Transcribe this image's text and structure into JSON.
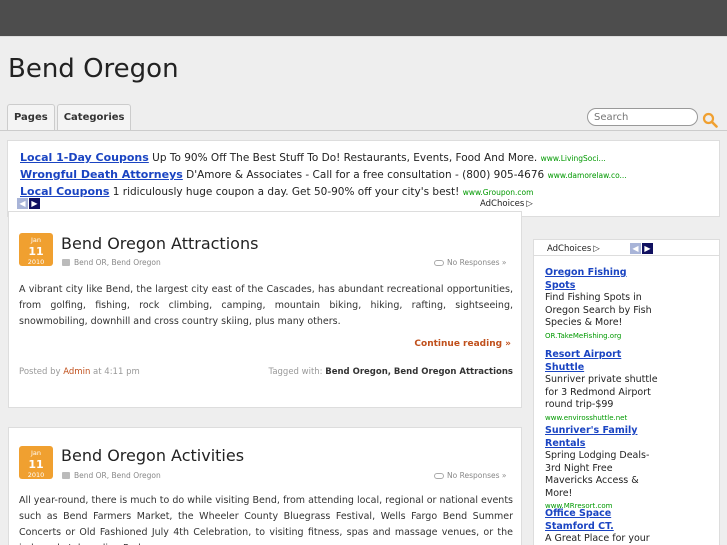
{
  "site": {
    "title": "Bend Oregon"
  },
  "nav": {
    "pages": "Pages",
    "categories": "Categories"
  },
  "search": {
    "placeholder": "Search"
  },
  "ads": [
    {
      "headline": "Local 1-Day Coupons",
      "text": "Up To 90% Off The Best Stuff To Do! Restaurants, Events, Food And More.",
      "url": "www.LivingSoci..."
    },
    {
      "headline": "Wrongful Death Attorneys",
      "text": "D'Amore & Associates - Call for a free consultation - (800) 905-4676",
      "url": "www.damorelaw.co..."
    },
    {
      "headline": "Local Coupons",
      "text": "1 ridiculously huge coupon a day. Get 50-90% off your city's best!",
      "url": "www.Groupon.com"
    }
  ],
  "adchoices": "AdChoices",
  "posts": [
    {
      "month": "Jan",
      "day": "11",
      "year": "2010",
      "title": "Bend Oregon Attractions",
      "categories": "Bend OR, Bend Oregon",
      "responses": "No Responses »",
      "excerpt": "A vibrant city like Bend, the largest city east of the Cascades, has abundant recreational opportunities, from golfing, fishing, rock climbing, camping, mountain biking, hiking, rafting, sightseeing, snowmobiling, downhill and cross country skiing, plus many others.",
      "continue": "Continue reading »",
      "posted_by": "Posted by",
      "author": "Admin",
      "time": "at 4:11 pm",
      "tagged": "Tagged with:",
      "tags": "Bend Oregon, Bend Oregon Attractions"
    },
    {
      "month": "Jan",
      "day": "11",
      "year": "2010",
      "title": "Bend Oregon Activities",
      "categories": "Bend OR, Bend Oregon",
      "responses": "No Responses »",
      "excerpt": "All year-round, there is much to do while visiting Bend, from attending local, regional or national events such as Bend Farmers Market, the Wheeler County Bluegrass Festival, Wells Fargo Bend Summer Concerts or Old Fashioned July 4th Celebration, to visiting fitness, spas and massage venues, or the indoor skateboarding Park."
    }
  ],
  "sidebar_ads": [
    {
      "headline": "Oregon Fishing Spots",
      "text": "Find Fishing Spots in Oregon Search by Fish Species & More!",
      "url": "OR.TakeMeFishing.org"
    },
    {
      "headline": "Resort Airport Shuttle",
      "text": "Sunriver private shuttle for 3 Redmond Airport round trip-$99",
      "url": "www.envirosshuttle.net"
    },
    {
      "headline": "Sunriver's Family Rentals",
      "text": "Spring Lodging Deals-3rd Night Free Mavericks Access & More!",
      "url": "www.MRresort.com"
    },
    {
      "headline": "Office Space Stamford CT.",
      "text": "A Great Place for your",
      "url": ""
    }
  ],
  "colors": {
    "accent": "#f0a030",
    "link": "#1a44c2",
    "continue": "#c0501c",
    "ad_url": "#009900"
  }
}
